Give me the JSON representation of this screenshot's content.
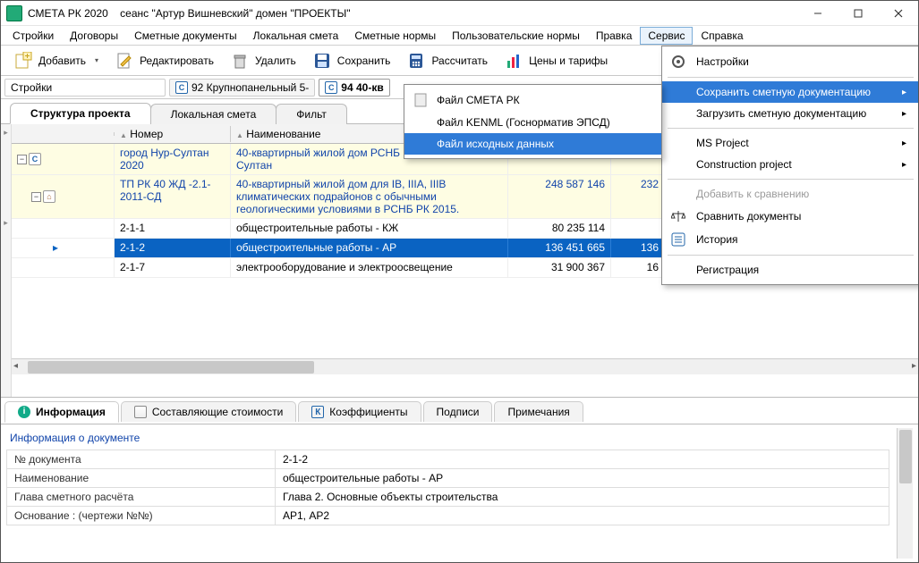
{
  "title": {
    "app": "СМЕТА РК 2020",
    "session": "сеанс \"Артур Вишневский\"  домен \"ПРОЕКТЫ\""
  },
  "menubar": {
    "items": [
      "Стройки",
      "Договоры",
      "Сметные документы",
      "Локальная смета",
      "Сметные нормы",
      "Пользовательские нормы",
      "Правка",
      "Сервис",
      "Справка"
    ],
    "active_index": 7
  },
  "toolbar": {
    "add": "Добавить",
    "edit": "Редактировать",
    "delete": "Удалить",
    "save": "Сохранить",
    "calc": "Рассчитать",
    "prices": "Цены и тарифы"
  },
  "breadcrumbs": {
    "root": "Стройки",
    "tabs": [
      {
        "icon": "C",
        "label": "92 Крупнопанельный 5-",
        "active": false
      },
      {
        "icon": "C",
        "label": "94 40-кв",
        "active": true
      }
    ]
  },
  "doc_tabs": {
    "items": [
      "Структура проекта",
      "Локальная смета",
      "Фильт"
    ],
    "active_index": 0
  },
  "grid": {
    "headers": {
      "num": "Номер",
      "name": "Наименование"
    },
    "rows": [
      {
        "level": 0,
        "cls": "group",
        "tree_icon": "C",
        "num": "город Нур-Султан 2020",
        "name": "40-квартирный жилой дом РСНБ РК 2015 г. Нур-Султан",
        "v1": "",
        "v2": ""
      },
      {
        "level": 1,
        "cls": "group",
        "tree_icon": "home",
        "num": "ТП РК 40 ЖД -2.1-2011-СД",
        "name": "40-квартирный жилой дом для IB, IIIА, IIIВ климатических подрайонов с обычными геологическими условиями в РСНБ РК 2015.",
        "v1": "248 587 146",
        "v2": "232 7"
      },
      {
        "level": 2,
        "cls": "sub",
        "tree_icon": "",
        "num": "2-1-1",
        "name": "общестроительные работы - КЖ",
        "v1": "80 235 114",
        "v2": ""
      },
      {
        "level": 2,
        "cls": "selected",
        "tree_icon": "",
        "num": "2-1-2",
        "name": "общестроительные работы - АР",
        "v1": "136 451 665",
        "v2": "136 4"
      },
      {
        "level": 2,
        "cls": "sub",
        "tree_icon": "",
        "num": "2-1-7",
        "name": "электрооборудование и электроосвещение",
        "v1": "31 900 367",
        "v2": "16 0"
      }
    ]
  },
  "service_menu": {
    "settings": "Настройки",
    "save_doc": "Сохранить сметную документацию",
    "load_doc": "Загрузить сметную документацию",
    "msproject": "MS Project",
    "construction": "Construction project",
    "add_compare": "Добавить к сравнению",
    "compare": "Сравнить документы",
    "history": "История",
    "register": "Регистрация"
  },
  "submenu": {
    "smeta": "Файл СМЕТА РК",
    "kenml": "Файл KENML (Госнорматив ЭПСД)",
    "source": "Файл исходных данных"
  },
  "bottom_tabs": {
    "info": "Информация",
    "components": "Составляющие стоимости",
    "coeff": "Коэффициенты",
    "signs": "Подписи",
    "notes": "Примечания"
  },
  "info_panel": {
    "title": "Информация о документе",
    "rows": [
      {
        "k": "№ документа",
        "v": "2-1-2"
      },
      {
        "k": "Наименование",
        "v": "общестроительные работы - АР"
      },
      {
        "k": "Глава сметного расчёта",
        "v": "Глава 2. Основные объекты строительства"
      },
      {
        "k": "Основание : (чертежи №№)",
        "v": "АР1, АР2"
      }
    ]
  }
}
